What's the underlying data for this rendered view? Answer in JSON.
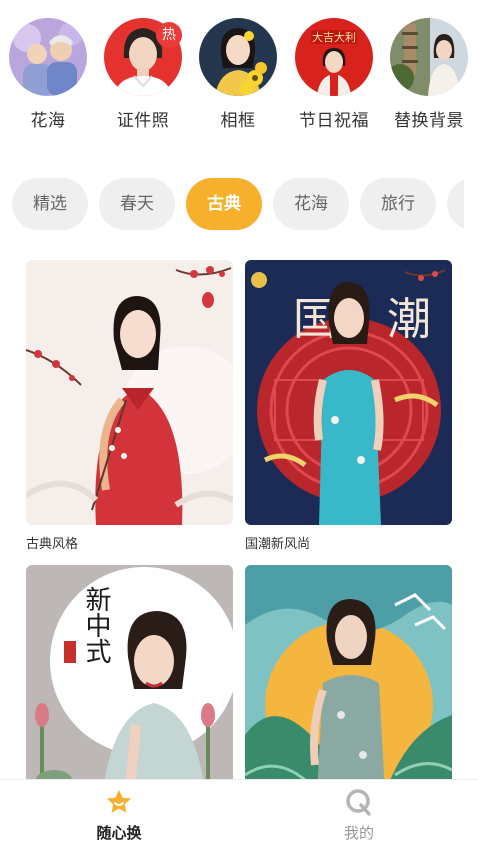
{
  "features": [
    {
      "label": "花海",
      "icon": "flower-portrait"
    },
    {
      "label": "证件照",
      "icon": "id-photo-portrait",
      "badge": "热"
    },
    {
      "label": "相框",
      "icon": "photo-frame-portrait"
    },
    {
      "label": "节日祝福",
      "icon": "holiday-greeting-portrait",
      "art_text": "大吉大利"
    },
    {
      "label": "替换背景",
      "icon": "background-replace-portrait"
    }
  ],
  "tabs": [
    {
      "label": "精选"
    },
    {
      "label": "春天"
    },
    {
      "label": "古典",
      "active": true
    },
    {
      "label": "花海"
    },
    {
      "label": "旅行"
    }
  ],
  "cards": [
    {
      "caption": "古典风格",
      "image": "classical-red-dress-portrait"
    },
    {
      "caption": "国潮新风尚",
      "image": "guochao-blue-qipao-portrait",
      "art_text": "国潮"
    },
    {
      "caption": "",
      "image": "new-chinese-style-portrait",
      "art_text": "新中式"
    },
    {
      "caption": "",
      "image": "landscape-qipao-portrait"
    }
  ],
  "nav": [
    {
      "label": "随心换",
      "icon": "star-face-icon",
      "active": true
    },
    {
      "label": "我的",
      "icon": "profile-q-icon"
    }
  ],
  "colors": {
    "accent": "#f7b02c",
    "tab_bg": "#efefef",
    "hot_badge": "#ea3a3a"
  }
}
